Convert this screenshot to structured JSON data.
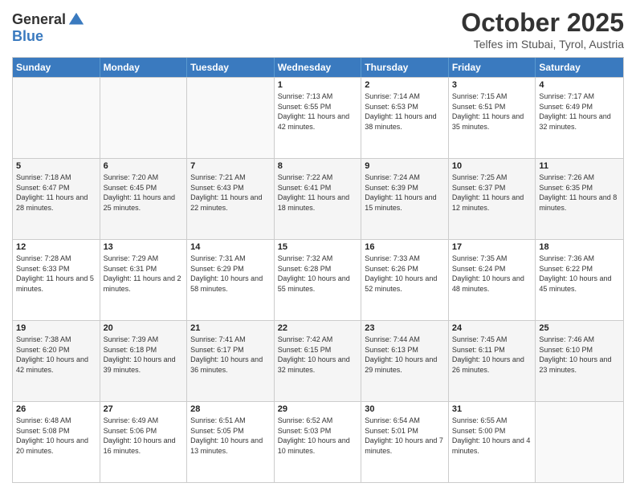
{
  "logo": {
    "general": "General",
    "blue": "Blue"
  },
  "header": {
    "month": "October 2025",
    "location": "Telfes im Stubai, Tyrol, Austria"
  },
  "weekdays": [
    "Sunday",
    "Monday",
    "Tuesday",
    "Wednesday",
    "Thursday",
    "Friday",
    "Saturday"
  ],
  "rows": [
    [
      {
        "day": "",
        "info": ""
      },
      {
        "day": "",
        "info": ""
      },
      {
        "day": "",
        "info": ""
      },
      {
        "day": "1",
        "info": "Sunrise: 7:13 AM\nSunset: 6:55 PM\nDaylight: 11 hours and 42 minutes."
      },
      {
        "day": "2",
        "info": "Sunrise: 7:14 AM\nSunset: 6:53 PM\nDaylight: 11 hours and 38 minutes."
      },
      {
        "day": "3",
        "info": "Sunrise: 7:15 AM\nSunset: 6:51 PM\nDaylight: 11 hours and 35 minutes."
      },
      {
        "day": "4",
        "info": "Sunrise: 7:17 AM\nSunset: 6:49 PM\nDaylight: 11 hours and 32 minutes."
      }
    ],
    [
      {
        "day": "5",
        "info": "Sunrise: 7:18 AM\nSunset: 6:47 PM\nDaylight: 11 hours and 28 minutes."
      },
      {
        "day": "6",
        "info": "Sunrise: 7:20 AM\nSunset: 6:45 PM\nDaylight: 11 hours and 25 minutes."
      },
      {
        "day": "7",
        "info": "Sunrise: 7:21 AM\nSunset: 6:43 PM\nDaylight: 11 hours and 22 minutes."
      },
      {
        "day": "8",
        "info": "Sunrise: 7:22 AM\nSunset: 6:41 PM\nDaylight: 11 hours and 18 minutes."
      },
      {
        "day": "9",
        "info": "Sunrise: 7:24 AM\nSunset: 6:39 PM\nDaylight: 11 hours and 15 minutes."
      },
      {
        "day": "10",
        "info": "Sunrise: 7:25 AM\nSunset: 6:37 PM\nDaylight: 11 hours and 12 minutes."
      },
      {
        "day": "11",
        "info": "Sunrise: 7:26 AM\nSunset: 6:35 PM\nDaylight: 11 hours and 8 minutes."
      }
    ],
    [
      {
        "day": "12",
        "info": "Sunrise: 7:28 AM\nSunset: 6:33 PM\nDaylight: 11 hours and 5 minutes."
      },
      {
        "day": "13",
        "info": "Sunrise: 7:29 AM\nSunset: 6:31 PM\nDaylight: 11 hours and 2 minutes."
      },
      {
        "day": "14",
        "info": "Sunrise: 7:31 AM\nSunset: 6:29 PM\nDaylight: 10 hours and 58 minutes."
      },
      {
        "day": "15",
        "info": "Sunrise: 7:32 AM\nSunset: 6:28 PM\nDaylight: 10 hours and 55 minutes."
      },
      {
        "day": "16",
        "info": "Sunrise: 7:33 AM\nSunset: 6:26 PM\nDaylight: 10 hours and 52 minutes."
      },
      {
        "day": "17",
        "info": "Sunrise: 7:35 AM\nSunset: 6:24 PM\nDaylight: 10 hours and 48 minutes."
      },
      {
        "day": "18",
        "info": "Sunrise: 7:36 AM\nSunset: 6:22 PM\nDaylight: 10 hours and 45 minutes."
      }
    ],
    [
      {
        "day": "19",
        "info": "Sunrise: 7:38 AM\nSunset: 6:20 PM\nDaylight: 10 hours and 42 minutes."
      },
      {
        "day": "20",
        "info": "Sunrise: 7:39 AM\nSunset: 6:18 PM\nDaylight: 10 hours and 39 minutes."
      },
      {
        "day": "21",
        "info": "Sunrise: 7:41 AM\nSunset: 6:17 PM\nDaylight: 10 hours and 36 minutes."
      },
      {
        "day": "22",
        "info": "Sunrise: 7:42 AM\nSunset: 6:15 PM\nDaylight: 10 hours and 32 minutes."
      },
      {
        "day": "23",
        "info": "Sunrise: 7:44 AM\nSunset: 6:13 PM\nDaylight: 10 hours and 29 minutes."
      },
      {
        "day": "24",
        "info": "Sunrise: 7:45 AM\nSunset: 6:11 PM\nDaylight: 10 hours and 26 minutes."
      },
      {
        "day": "25",
        "info": "Sunrise: 7:46 AM\nSunset: 6:10 PM\nDaylight: 10 hours and 23 minutes."
      }
    ],
    [
      {
        "day": "26",
        "info": "Sunrise: 6:48 AM\nSunset: 5:08 PM\nDaylight: 10 hours and 20 minutes."
      },
      {
        "day": "27",
        "info": "Sunrise: 6:49 AM\nSunset: 5:06 PM\nDaylight: 10 hours and 16 minutes."
      },
      {
        "day": "28",
        "info": "Sunrise: 6:51 AM\nSunset: 5:05 PM\nDaylight: 10 hours and 13 minutes."
      },
      {
        "day": "29",
        "info": "Sunrise: 6:52 AM\nSunset: 5:03 PM\nDaylight: 10 hours and 10 minutes."
      },
      {
        "day": "30",
        "info": "Sunrise: 6:54 AM\nSunset: 5:01 PM\nDaylight: 10 hours and 7 minutes."
      },
      {
        "day": "31",
        "info": "Sunrise: 6:55 AM\nSunset: 5:00 PM\nDaylight: 10 hours and 4 minutes."
      },
      {
        "day": "",
        "info": ""
      }
    ]
  ]
}
